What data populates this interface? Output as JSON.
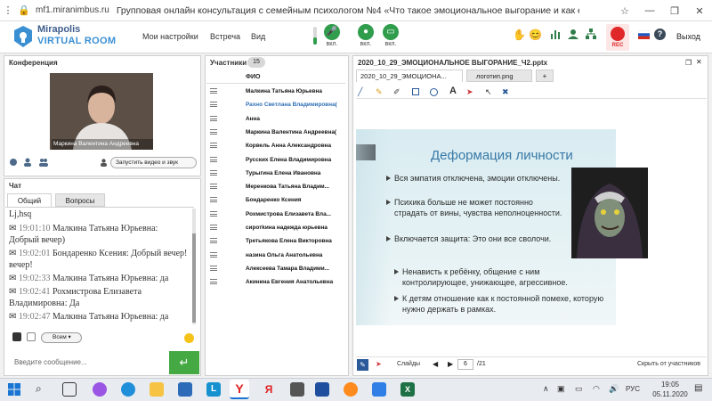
{
  "browser": {
    "url": "mf1.miranimbus.ru",
    "page_title": "Групповая онлайн консультация с семейным психологом №4 «Что такое эмоциональное выгорание и как е..."
  },
  "app": {
    "brand_name": "Mirapolis",
    "brand_sub": "VIRTUAL ROOM",
    "menu": [
      "Мои настройки",
      "Встреча",
      "Вид"
    ],
    "mic_label": "вкл.",
    "cam_label": "вкл.",
    "screen_label": "вкл.",
    "rec_label": "REC",
    "exit_label": "Выход",
    "accent": "#2f9d4c",
    "brand_color": "#3a8fd3"
  },
  "conference": {
    "title": "Конференция",
    "presenter_name": "Маркина Валентина Андреевна",
    "start_video_label": "Запустить видео и звук"
  },
  "chat": {
    "title": "Чат",
    "tabs": [
      "Общий",
      "Вопросы"
    ],
    "messages": [
      {
        "time": "",
        "author": "",
        "text": "Lj,hsq"
      },
      {
        "time": "19:01:10",
        "author": "Малкина Татьяна Юрьевна:",
        "text": "Добрый вечер)"
      },
      {
        "time": "19:02:01",
        "author": "Бондаренко Ксения:",
        "text": "Добрый вечер!"
      },
      {
        "time": "19:02:33",
        "author": "Малкина Татьяна Юрьевна:",
        "text": "да"
      },
      {
        "time": "19:02:41",
        "author": "Рохмистрова Елизавета Владимировна:",
        "text": "Да"
      },
      {
        "time": "19:02:47",
        "author": "Малкина Татьяна Юрьевна:",
        "text": "да"
      }
    ],
    "recipient": "Всем",
    "input_placeholder": "Введите сообщение..."
  },
  "participants": {
    "title": "Участники",
    "count": "15",
    "column_header": "ФИО",
    "rows": [
      {
        "name": "Малкина Татьяна Юрьевна",
        "highlight": false
      },
      {
        "name": "Рахно Светлана Владимировна(",
        "highlight": true
      },
      {
        "name": "Анна",
        "highlight": false
      },
      {
        "name": "Маркина Валентина Андреевна(",
        "highlight": false
      },
      {
        "name": "Корвель Анна Александровна",
        "highlight": false
      },
      {
        "name": "Русских Елена Владимировна",
        "highlight": false
      },
      {
        "name": "Турыгина Елена Ивановна",
        "highlight": false
      },
      {
        "name": "Меренкова Татьяна Владим...",
        "highlight": false
      },
      {
        "name": "Бондаренко Ксения",
        "highlight": false
      },
      {
        "name": "Рохмистрова Елизавета Вла...",
        "highlight": false
      },
      {
        "name": "сиротkина надежда юрьевна",
        "highlight": false
      },
      {
        "name": "Третьякова Елена Викторовна",
        "highlight": false
      },
      {
        "name": "назина Ольга Анатольевна",
        "highlight": false
      },
      {
        "name": "Алексеева Тамара Владими...",
        "highlight": false
      },
      {
        "name": "Акинина Евгения Анатольевна",
        "highlight": false
      }
    ]
  },
  "presentation": {
    "file_title": "2020_10_29_ЭМОЦИОНАЛЬНОЕ ВЫГОРАНИЕ_Ч2.pptx",
    "tabs": [
      "2020_10_29_ЭМОЦИОНА...",
      "логотип.png",
      "+"
    ],
    "slide_heading": "Деформация личности",
    "bullets": [
      "Вся эмпатия отключена, эмоции отключены.",
      "Психика больше не может постоянно страдать от вины, чувства неполноценности.",
      "Включается защита: Это они все сволочи.",
      "Ненависть к ребёнку, общение с ним контролирующее, унижающее, агрессивное.",
      "К детям отношение как к постоянной помехе, которую нужно держать в рамках."
    ],
    "slides_label": "Слайды",
    "current_slide": "6",
    "total_slides": "/21",
    "hide_label": "Скрыть от участников"
  },
  "taskbar": {
    "lang": "РУС",
    "time": "19:05",
    "date": "05.11.2020"
  }
}
